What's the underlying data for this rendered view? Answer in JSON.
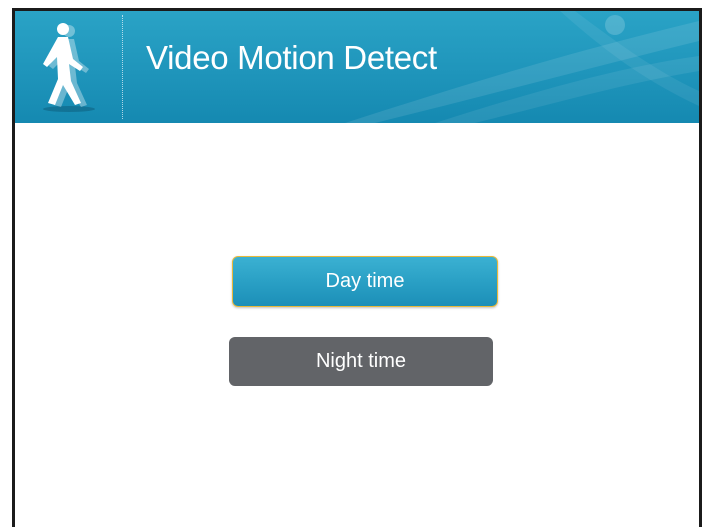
{
  "header": {
    "title": "Video Motion Detect",
    "icon": "walking-person-icon",
    "background_color": "#1f95bb"
  },
  "buttons": {
    "day_time_label": "Day time",
    "night_time_label": "Night time",
    "selected": "Day time",
    "day_color": "#2aa0c5",
    "night_color": "#626468"
  }
}
